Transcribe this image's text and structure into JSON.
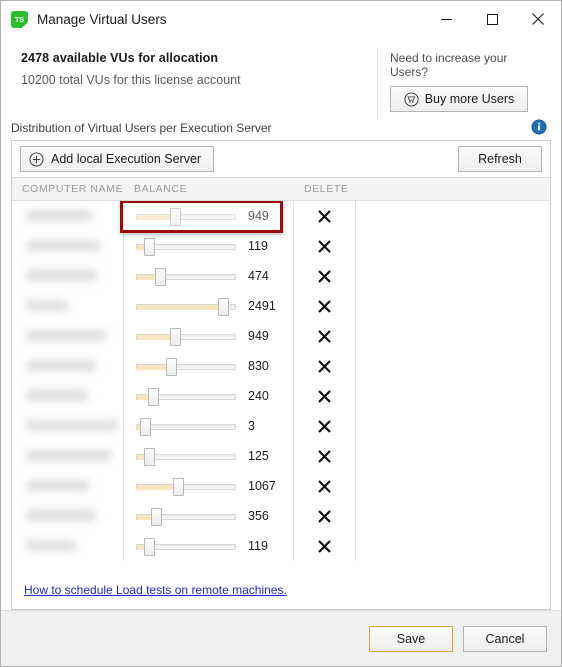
{
  "window": {
    "title": "Manage Virtual Users",
    "app_icon": "ts-logo-icon",
    "minimize_label": "Minimize",
    "maximize_label": "Maximize",
    "close_label": "Close"
  },
  "summary": {
    "available_text": "2478 available VUs for allocation",
    "total_text": "10200 total VUs for this license account",
    "need_users_label": "Need to increase your Users?",
    "buy_button": "Buy more Users",
    "buy_icon": "shopping-cart-icon"
  },
  "distribution": {
    "label": "Distribution of Virtual Users per Execution Server",
    "info_icon": "info-icon",
    "add_server_button": "Add local Execution Server",
    "add_server_icon": "plus-circle-icon",
    "refresh_button": "Refresh",
    "help_link": "How to schedule Load tests on remote machines.",
    "columns": [
      "COMPUTER NAME",
      "BALANCE",
      "DELETE"
    ],
    "delete_icon": "x-icon",
    "slider_max": 2500,
    "highlighted_row_index": 0,
    "rows": [
      {
        "name": "",
        "balance": 949,
        "name_redacted": true,
        "name_blur_width": 66
      },
      {
        "name": "",
        "balance": 119,
        "name_redacted": true,
        "name_blur_width": 74
      },
      {
        "name": "",
        "balance": 474,
        "name_redacted": true,
        "name_blur_width": 72
      },
      {
        "name": "",
        "balance": 2491,
        "name_redacted": true,
        "name_blur_width": 42
      },
      {
        "name": "",
        "balance": 949,
        "name_redacted": true,
        "name_blur_width": 80
      },
      {
        "name": "",
        "balance": 830,
        "name_redacted": true,
        "name_blur_width": 70
      },
      {
        "name": "",
        "balance": 240,
        "name_redacted": true,
        "name_blur_width": 62
      },
      {
        "name": "",
        "balance": 3,
        "name_redacted": true,
        "name_blur_width": 92
      },
      {
        "name": "",
        "balance": 125,
        "name_redacted": true,
        "name_blur_width": 86
      },
      {
        "name": "",
        "balance": 1067,
        "name_redacted": true,
        "name_blur_width": 64
      },
      {
        "name": "",
        "balance": 356,
        "name_redacted": true,
        "name_blur_width": 70
      },
      {
        "name": "",
        "balance": 119,
        "name_redacted": true,
        "name_blur_width": 50
      }
    ]
  },
  "footer": {
    "save_label": "Save",
    "cancel_label": "Cancel"
  },
  "colors": {
    "accent_green": "#2dbe2d",
    "info_blue": "#1f6fb5",
    "link_blue": "#1a28d8",
    "highlight_red": "#9c0c0c",
    "slider_fill": "#f6e7c0",
    "save_border": "#d9a441"
  }
}
